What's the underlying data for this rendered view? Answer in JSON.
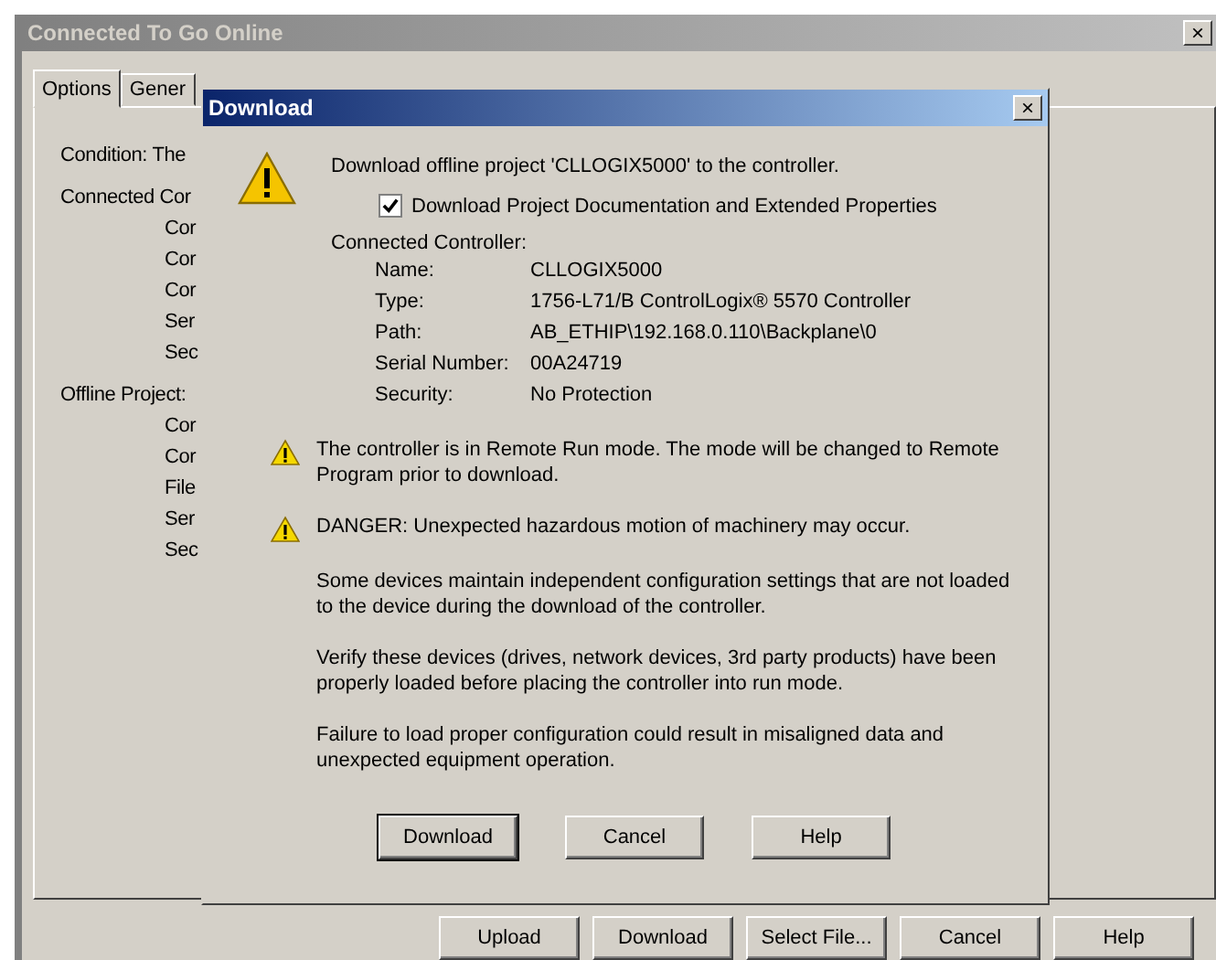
{
  "window": {
    "title": "Connected To Go Online",
    "close": "×"
  },
  "tabs": [
    {
      "label": "Options",
      "selected": true
    },
    {
      "label": "Gener",
      "selected": false
    }
  ],
  "panel": {
    "items": [
      {
        "label": "Condition:  The"
      },
      {
        "label": "Connected Cor",
        "children": [
          {
            "label": "Cor"
          },
          {
            "label": "Cor"
          },
          {
            "label": "Cor"
          },
          {
            "label": "Ser"
          },
          {
            "label": "Sec"
          }
        ]
      },
      {
        "label": "Offline Project:",
        "children": [
          {
            "label": "Cor"
          },
          {
            "label": "Cor"
          },
          {
            "label": "File"
          },
          {
            "label": "Ser"
          },
          {
            "label": "Sec"
          }
        ]
      }
    ]
  },
  "buttons": [
    {
      "label": "Upload"
    },
    {
      "label": "Download"
    },
    {
      "label": "Select File..."
    },
    {
      "label": "Cancel"
    },
    {
      "label": "Help"
    }
  ],
  "dialog": {
    "title": "Download",
    "close": "×",
    "message": "Download offline project 'CLLOGIX5000' to the controller.",
    "checkbox": {
      "label": "Download Project Documentation and Extended Properties",
      "checked": true
    },
    "controller_heading": "Connected Controller:",
    "controller": [
      {
        "label": "Name:",
        "value": "CLLOGIX5000"
      },
      {
        "label": "Type:",
        "value": "1756-L71/B ControlLogix® 5570 Controller"
      },
      {
        "label": "Path:",
        "value": "AB_ETHIP\\192.168.0.110\\Backplane\\0"
      },
      {
        "label": "Serial Number:",
        "value": "00A24719"
      },
      {
        "label": "Security:",
        "value": "No Protection"
      }
    ],
    "warnings": [
      "The controller is in Remote Run mode. The mode will be changed to Remote Program prior to download.",
      "DANGER: Unexpected hazardous motion of machinery may occur."
    ],
    "paragraphs": [
      "Some devices maintain independent configuration settings that are not loaded to the device during the download of the controller.",
      "Verify these devices (drives, network devices, 3rd party products) have been properly loaded before placing the controller into run mode.",
      "Failure to load proper configuration could result in misaligned data and unexpected equipment operation."
    ],
    "buttons": [
      {
        "label": "Download",
        "default": true
      },
      {
        "label": "Cancel",
        "default": false
      },
      {
        "label": "Help",
        "default": false
      }
    ]
  }
}
